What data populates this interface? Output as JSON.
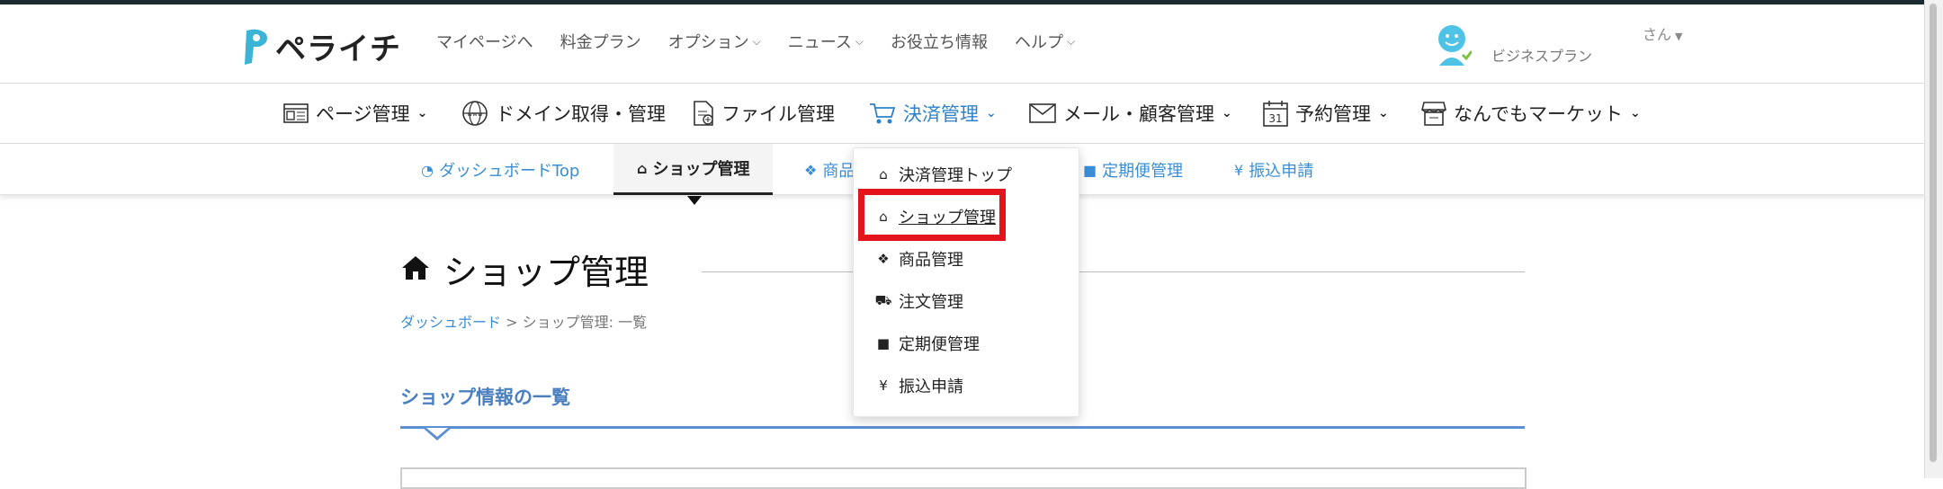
{
  "app": {
    "logo_text": "ペライチ"
  },
  "topnav": [
    {
      "label": "マイページへ",
      "caret": false
    },
    {
      "label": "料金プラン",
      "caret": false
    },
    {
      "label": "オプション",
      "caret": true
    },
    {
      "label": "ニュース",
      "caret": true
    },
    {
      "label": "お役立ち情報",
      "caret": false
    },
    {
      "label": "ヘルプ",
      "caret": true
    }
  ],
  "user": {
    "plan": "ビジネスプラン",
    "name_suffix": "さん"
  },
  "mainnav": [
    {
      "label": "ページ管理",
      "icon": "page-icon"
    },
    {
      "label": "ドメイン取得・管理",
      "icon": "www-icon"
    },
    {
      "label": "ファイル管理",
      "icon": "file-icon"
    },
    {
      "label": "決済管理",
      "icon": "cart-icon",
      "active": true
    },
    {
      "label": "メール・顧客管理",
      "icon": "mail-icon"
    },
    {
      "label": "予約管理",
      "icon": "calendar-icon"
    },
    {
      "label": "なんでもマーケット",
      "icon": "store-icon"
    }
  ],
  "subnav": {
    "dashboard": "ダッシュボードTop",
    "shop": "ショップ管理",
    "products_partial": "商品",
    "subscription": "定期便管理",
    "transfer": "振込申請"
  },
  "dropdown": {
    "items": [
      "決済管理トップ",
      "ショップ管理",
      "商品管理",
      "注文管理",
      "定期便管理",
      "振込申請"
    ]
  },
  "page": {
    "title": "ショップ管理",
    "breadcrumb_link": "ダッシュボード",
    "breadcrumb_sep": ">",
    "breadcrumb_current": "ショップ管理: 一覧",
    "section_title": "ショップ情報の一覧"
  },
  "colors": {
    "accent": "#2f80c8",
    "link": "#3a8ed6",
    "highlight": "#e3141c",
    "section": "#4a7fc0"
  }
}
